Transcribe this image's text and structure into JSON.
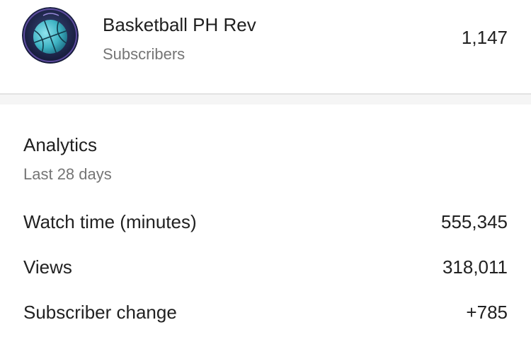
{
  "channel": {
    "avatar_icon": "basketball-icon",
    "name": "Basketball PH Rev",
    "subscribers_label": "Subscribers",
    "subscribers_count": "1,147"
  },
  "analytics": {
    "title": "Analytics",
    "period": "Last 28 days",
    "metrics": [
      {
        "label": "Watch time (minutes)",
        "value": "555,345"
      },
      {
        "label": "Views",
        "value": "318,011"
      },
      {
        "label": "Subscriber change",
        "value": "+785"
      }
    ]
  }
}
